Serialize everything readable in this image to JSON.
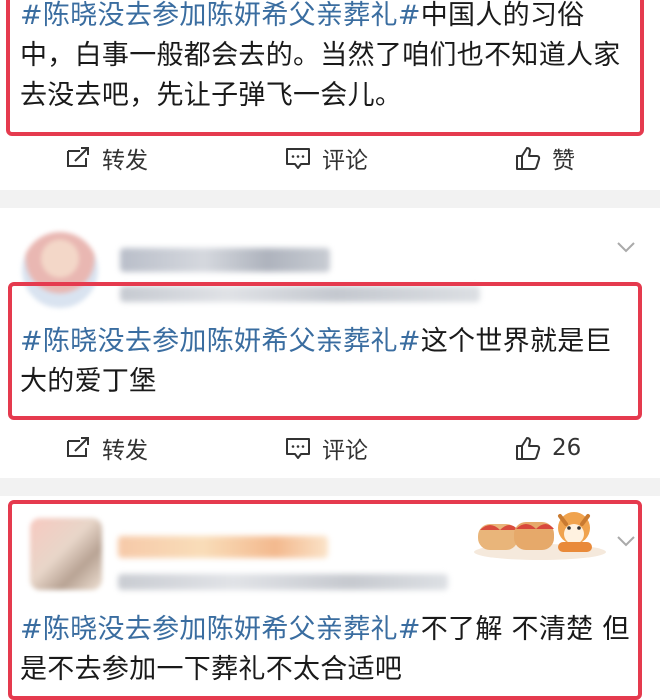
{
  "posts": [
    {
      "hashtag": "#陈晓没去参加陈妍希父亲葬礼#",
      "line1_rest": "中国人的习俗",
      "line2": "中，白事一般都会去的。当然了咱们也不知道人家",
      "line3": "去没去吧，先让子弹飞一会儿。",
      "actions": {
        "repost": "转发",
        "comment": "评论",
        "like": "赞"
      }
    },
    {
      "username": "",
      "hashtag": "#陈晓没去参加陈妍希父亲葬礼#",
      "line1_rest": "这个世界就是巨",
      "line2": "大的爱丁堡",
      "actions": {
        "repost": "转发",
        "comment": "评论",
        "like": "26"
      }
    },
    {
      "username": "",
      "hashtag": "#陈晓没去参加陈妍希父亲葬礼#",
      "line1_rest": "不了解 不清楚 但",
      "line2": "是不去参加一下葬礼不太合适吧"
    }
  ],
  "colors": {
    "highlight_border": "#e53a4e",
    "hashtag": "#3a6da0",
    "divider": "#f2f2f2"
  },
  "icons": [
    "repost-icon",
    "comment-icon",
    "like-icon",
    "chevron-down-icon",
    "sticker-image"
  ]
}
